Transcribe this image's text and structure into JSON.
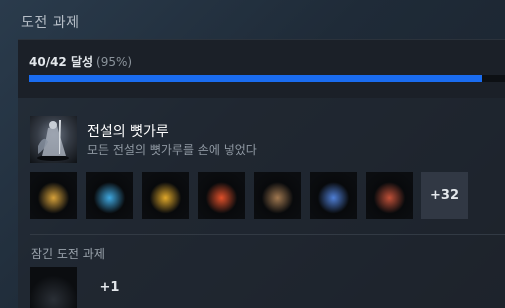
{
  "section_title": "도전 과제",
  "progress": {
    "count_label": "40/42 달성",
    "percent_label": "(95%)",
    "fraction": 0.9524,
    "bar_color": "#1a6cf0"
  },
  "featured": {
    "title": "전설의 뼛가루",
    "description": "모든 전설의 뼛가루를 손에 넣었다",
    "icon": "spirit-knight-icon"
  },
  "achievements": [
    {
      "icon": "golden-seed-icon",
      "accent": "#d6a13a"
    },
    {
      "icon": "comet-sorcery-icon",
      "accent": "#3fa8e0"
    },
    {
      "icon": "flame-pillar-icon",
      "accent": "#e0a82a"
    },
    {
      "icon": "fire-beast-icon",
      "accent": "#e0502a"
    },
    {
      "icon": "throne-icon",
      "accent": "#a07850"
    },
    {
      "icon": "moon-spirit-icon",
      "accent": "#4f7fd6"
    },
    {
      "icon": "giant-warrior-icon",
      "accent": "#c05038"
    }
  ],
  "more_label": "+32",
  "hidden_section": {
    "title": "잠긴 도전 과제",
    "more_label": "+1"
  }
}
